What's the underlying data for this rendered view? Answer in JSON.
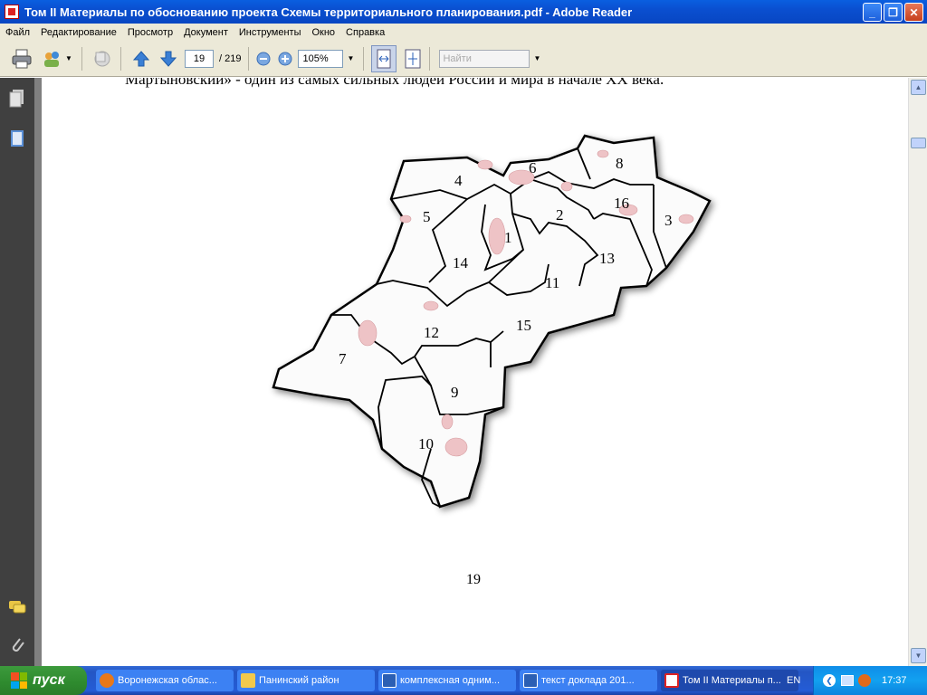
{
  "window": {
    "title": "Том II Материалы по обоснованию проекта Схемы территориального планирования.pdf - Adobe Reader",
    "minimize": "_",
    "maximize": "❐",
    "close": "✕"
  },
  "menu": {
    "items": [
      "Файл",
      "Редактирование",
      "Просмотр",
      "Документ",
      "Инструменты",
      "Окно",
      "Справка"
    ]
  },
  "toolbar": {
    "current_page": "19",
    "total_pages": "/ 219",
    "zoom": "105%",
    "search_placeholder": "Найти"
  },
  "document": {
    "text_line": "Мартыновский» - один из самых сильных людей России и мира в начале XX века.",
    "page_number": "19",
    "map_labels": [
      "1",
      "2",
      "3",
      "4",
      "5",
      "6",
      "7",
      "8",
      "9",
      "10",
      "11",
      "12",
      "13",
      "14",
      "15",
      "16"
    ]
  },
  "taskbar": {
    "start": "пуск",
    "tasks": [
      {
        "label": "Воронежская облас...",
        "color": "#e8781a"
      },
      {
        "label": "Панинский район",
        "color": "#f2c94c"
      },
      {
        "label": "комплексная одним...",
        "color": "#2b5fb4"
      },
      {
        "label": "текст доклада 201...",
        "color": "#2b5fb4"
      },
      {
        "label": "Том II Материалы п...",
        "color": "#d22"
      }
    ],
    "lang": "EN",
    "clock": "17:37"
  }
}
